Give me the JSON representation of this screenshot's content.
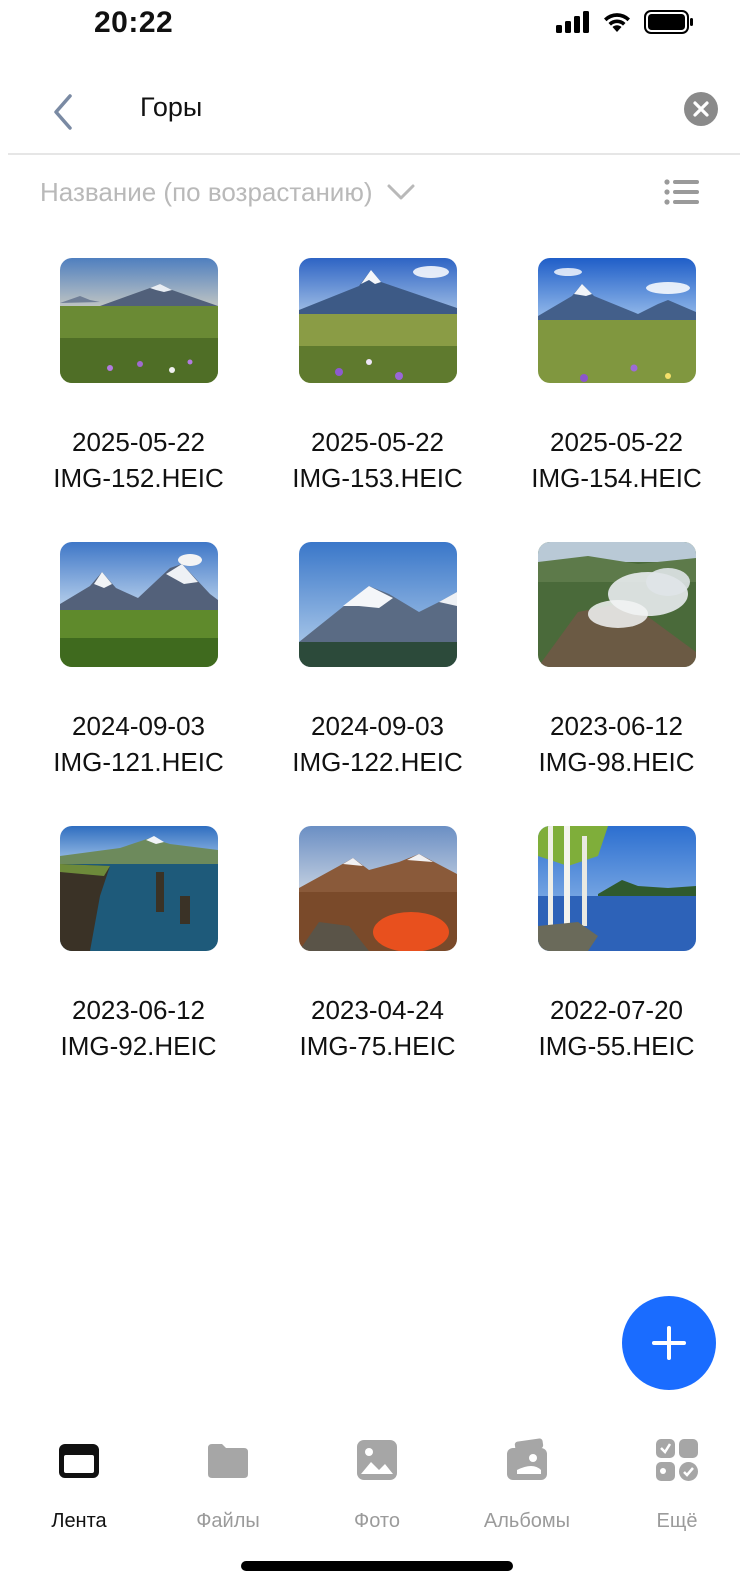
{
  "status_bar": {
    "time": "20:22"
  },
  "search": {
    "query": "Горы"
  },
  "sort": {
    "label": "Название (по возрастанию)"
  },
  "photos": [
    {
      "date": "2025-05-22",
      "name": "IMG-152.HEIC"
    },
    {
      "date": "2025-05-22",
      "name": "IMG-153.HEIC"
    },
    {
      "date": "2025-05-22",
      "name": "IMG-154.HEIC"
    },
    {
      "date": "2024-09-03",
      "name": "IMG-121.HEIC"
    },
    {
      "date": "2024-09-03",
      "name": "IMG-122.HEIC"
    },
    {
      "date": "2023-06-12",
      "name": "IMG-98.HEIC"
    },
    {
      "date": "2023-06-12",
      "name": "IMG-92.HEIC"
    },
    {
      "date": "2023-04-24",
      "name": "IMG-75.HEIC"
    },
    {
      "date": "2022-07-20",
      "name": "IMG-55.HEIC"
    }
  ],
  "tabs": [
    {
      "label": "Лента",
      "icon": "feed-icon",
      "active": true
    },
    {
      "label": "Файлы",
      "icon": "folder-icon",
      "active": false
    },
    {
      "label": "Фото",
      "icon": "photo-icon",
      "active": false
    },
    {
      "label": "Альбомы",
      "icon": "albums-icon",
      "active": false
    },
    {
      "label": "Ещё",
      "icon": "more-apps-icon",
      "active": false
    }
  ],
  "colors": {
    "accent": "#1a6cff",
    "inactive": "#9b9b9b",
    "sort_text": "#b9b9b9"
  }
}
